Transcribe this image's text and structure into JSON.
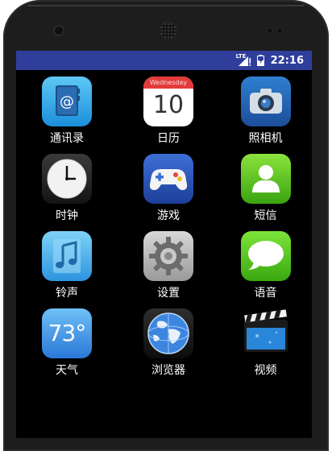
{
  "status_bar": {
    "network": "LTE",
    "time": "22:16"
  },
  "apps": [
    {
      "label": "通讯录",
      "icon": "contacts-icon"
    },
    {
      "label": "日历",
      "icon": "calendar-icon",
      "weekday": "Wednesday",
      "day": "10"
    },
    {
      "label": "照相机",
      "icon": "camera-icon"
    },
    {
      "label": "时钟",
      "icon": "clock-icon"
    },
    {
      "label": "游戏",
      "icon": "gamepad-icon"
    },
    {
      "label": "短信",
      "icon": "contact-person-icon"
    },
    {
      "label": "铃声",
      "icon": "music-note-icon"
    },
    {
      "label": "设置",
      "icon": "gear-icon"
    },
    {
      "label": "语音",
      "icon": "speech-bubble-icon"
    },
    {
      "label": "天气",
      "icon": "weather-icon",
      "temperature": "73°"
    },
    {
      "label": "浏览器",
      "icon": "globe-icon"
    },
    {
      "label": "视频",
      "icon": "clapperboard-icon"
    }
  ],
  "colors": {
    "status_bar": "#2f3e9a",
    "screen_bg": "#000000",
    "device_frame": "#1d1d1d"
  }
}
